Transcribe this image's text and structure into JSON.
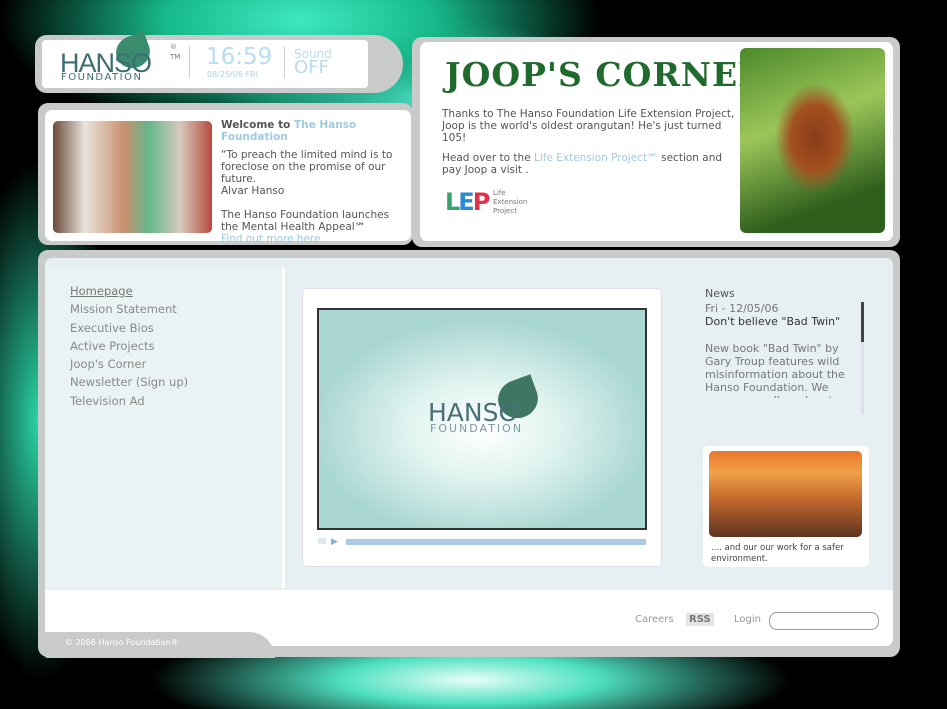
{
  "header": {
    "logo_text": "HANSO",
    "logo_sub": "FOUNDATION",
    "trademarks": "®\nTM",
    "time": "16:59",
    "date": "08/25/06 FRI",
    "sound_label": "Sound",
    "sound_state": "OFF"
  },
  "welcome": {
    "title_prefix": "Welcome to",
    "title_link": "The Hanso Foundation",
    "quote": "“To preach the limited mind is to foreclose on the promise of our future.",
    "author": "Alvar Hanso",
    "announcement": "The Hanso Foundation launches the Mental Health Appeal℠",
    "link": "Find out more here."
  },
  "joop": {
    "title": "JOOP'S CORNER",
    "text1": "Thanks to The Hanso Foundation Life Extension Project, Joop is the world's oldest orangutan! He's just turned 105!",
    "text2_prefix": "Head over to the",
    "text2_link": "Life Extension Project℠",
    "text2_suffix": "section and pay Joop a visit .",
    "lep_logo": "LEP",
    "lep_caption": "Life Extension Project"
  },
  "nav": {
    "items": [
      {
        "label": "Homepage"
      },
      {
        "label": "Mission Statement"
      },
      {
        "label": "Executive Bios"
      },
      {
        "label": "Active Projects"
      },
      {
        "label": "Joop's Corner"
      },
      {
        "label": "Newsletter (Sign up)"
      },
      {
        "label": "Television Ad"
      }
    ]
  },
  "video": {
    "logo_text": "HANSO",
    "logo_sub": "FOUNDATION",
    "play_icon": "play-icon"
  },
  "news": {
    "heading": "News",
    "date": "Fri - 12/05/06",
    "title": "Don't believe \"Bad Twin\"",
    "body": "New book \"Bad Twin\" by Gary Troup features wild misinformation about the Hanso Foundation. We encourage all readers to"
  },
  "promo": {
    "caption": ".... and our our work for a safer environment."
  },
  "footer": {
    "copyright": "© 2006 Hanso Foundation®",
    "careers": "Careers",
    "rss": "RSS",
    "login": "Login"
  },
  "colors": {
    "accent": "#9fcbe2",
    "joop_green": "#1f6a2c",
    "panel_gray": "#c9cbcb"
  }
}
